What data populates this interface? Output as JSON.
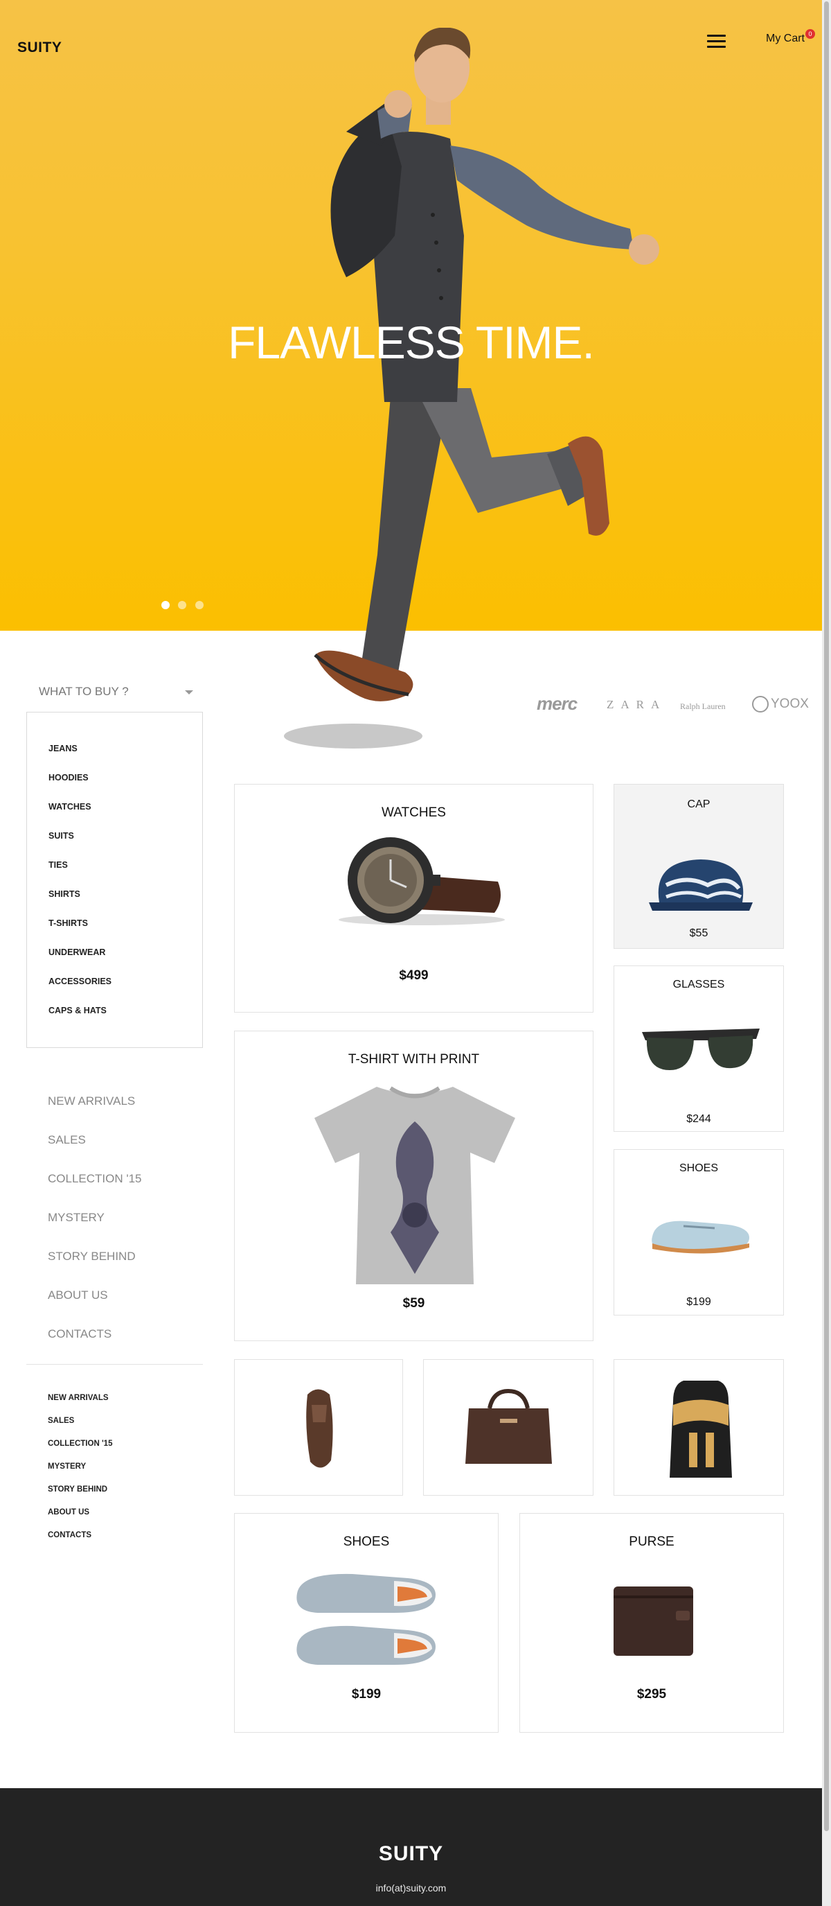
{
  "header": {
    "logo": "SUITY",
    "cart_label": "My Cart",
    "cart_count": "0"
  },
  "hero": {
    "title": "FLAWLESS TIME.",
    "slides_total": 3,
    "active_slide": 1
  },
  "sidebar": {
    "dropdown_label": "WHAT TO BUY ?",
    "categories": [
      "JEANS",
      "HOODIES",
      "WATCHES",
      "SUITS",
      "TIES",
      "SHIRTS",
      "T-SHIRTS",
      "UNDERWEAR",
      "ACCESSORIES",
      "CAPS & HATS"
    ],
    "nav_large": [
      "NEW ARRIVALS",
      "SALES",
      "COLLECTION '15",
      "MYSTERY",
      "STORY BEHIND",
      "ABOUT US",
      "CONTACTS"
    ],
    "nav_small": [
      "NEW ARRIVALS",
      "SALES",
      "COLLECTION '15",
      "MYSTERY",
      "STORY BEHIND",
      "ABOUT US",
      "CONTACTS"
    ]
  },
  "brands": {
    "merc": "merc",
    "zara": "ZARA",
    "ralph_lauren": "Ralph Lauren",
    "yoox": "YOOX"
  },
  "products": {
    "watches": {
      "title": "WATCHES",
      "price": "$499"
    },
    "cap": {
      "title": "CAP",
      "price": "$55"
    },
    "glasses": {
      "title": "GLASSES",
      "price": "$244"
    },
    "tshirt": {
      "title": "T-SHIRT WITH PRINT",
      "price": "$59"
    },
    "shoes_small": {
      "title": "SHOES",
      "price": "$199"
    },
    "shoes_large": {
      "title": "SHOES",
      "price": "$199"
    },
    "purse": {
      "title": "PURSE",
      "price": "$295"
    }
  },
  "footer": {
    "logo": "SUITY",
    "email": "info(at)suity.com"
  },
  "colors": {
    "hero_yellow": "#f8c230",
    "footer_bg": "#232323",
    "cart_badge": "#e03030"
  }
}
